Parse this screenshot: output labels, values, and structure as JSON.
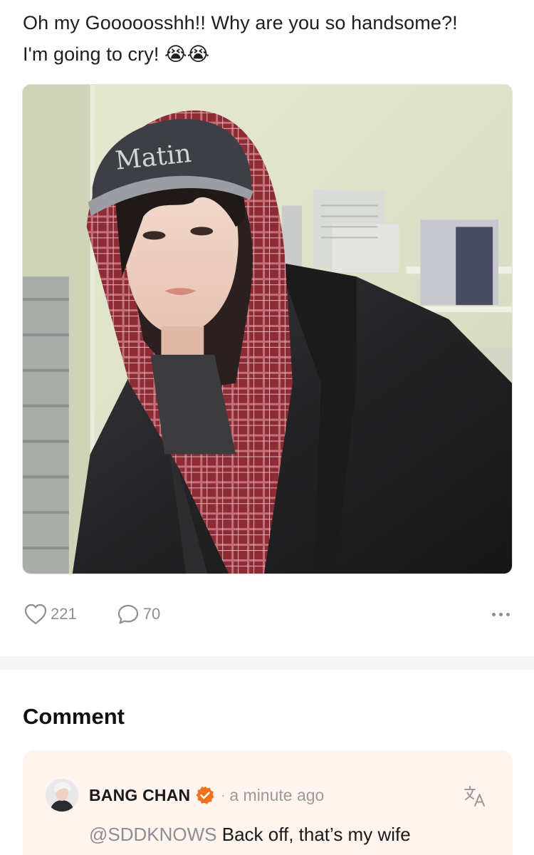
{
  "post": {
    "text_line1": "Oh my Gooooosshh!! Why are you so handsome?!",
    "text_line2": "I'm going to cry! 😭😭",
    "image": {
      "cap_text": "Matin",
      "description_icon": "photo-image"
    }
  },
  "actions": {
    "likes_count": "221",
    "comments_count": "70",
    "like_icon": "heart-icon",
    "comment_icon": "speech-bubble-icon",
    "more_icon": "more-dots-icon"
  },
  "comments": {
    "title": "Comment",
    "items": [
      {
        "author": "BANG CHAN",
        "separator": "·",
        "time": "a minute ago",
        "mention": "@SDDKNOWS",
        "text": "Back off, that’s my wife",
        "verified_icon": "verified-badge-icon",
        "translate_icon": "translate-icon"
      }
    ]
  },
  "colors": {
    "accent_orange": "#f0701d",
    "comment_bg": "#fff4ee",
    "muted_text": "#8e8e93",
    "divider": "#f5f5f5"
  }
}
